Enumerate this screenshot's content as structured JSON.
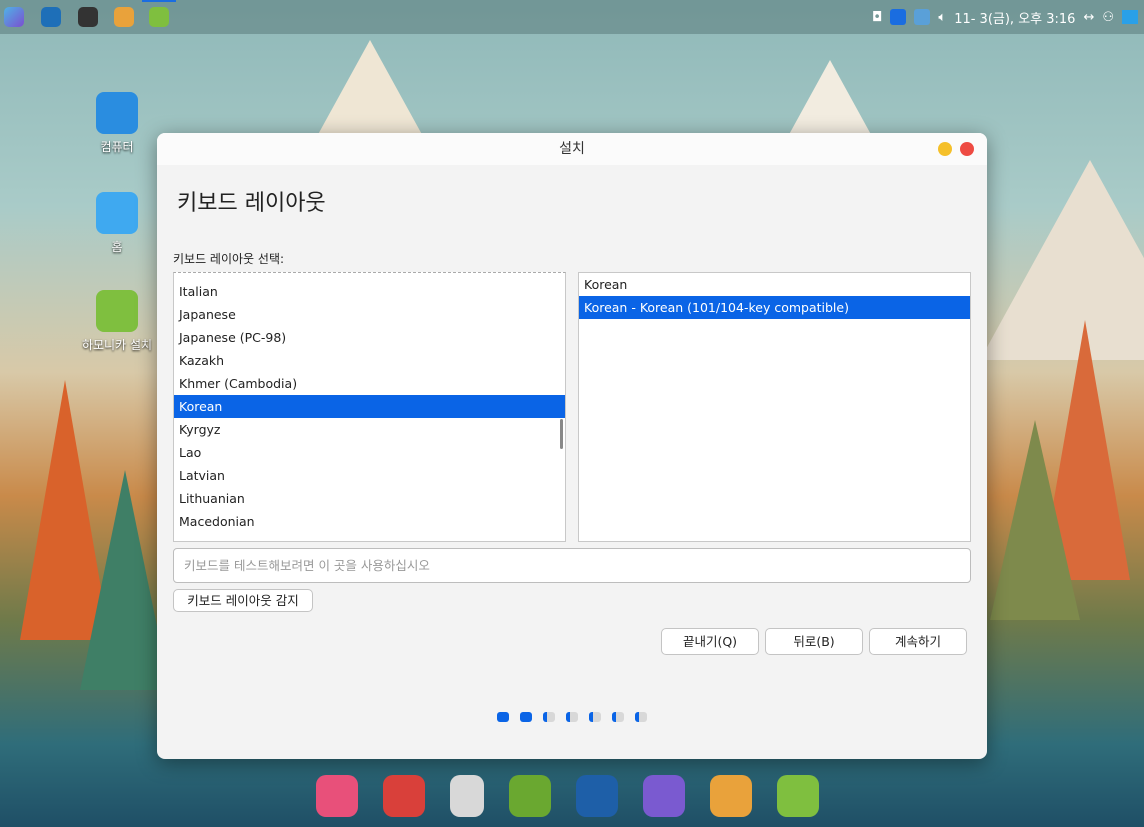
{
  "topbar": {
    "apps": [
      "launcher-icon",
      "browser-icon",
      "terminal-icon",
      "files-icon",
      "installer-icon"
    ],
    "clock": "11- 3(금), 오후 3:16"
  },
  "desktop": {
    "icons": [
      {
        "label": "컴퓨터"
      },
      {
        "label": "홈"
      },
      {
        "label": "하모니카 설치"
      }
    ]
  },
  "window": {
    "title": "설치",
    "heading": "키보드 레이아웃",
    "select_label": "키보드 레이아웃 선택:",
    "layouts": [
      "Italian",
      "Japanese",
      "Japanese (PC-98)",
      "Kazakh",
      "Khmer (Cambodia)",
      "Korean",
      "Kyrgyz",
      "Lao",
      "Latvian",
      "Lithuanian",
      "Macedonian"
    ],
    "selected_layout": "Korean",
    "variants": [
      "Korean",
      "Korean - Korean (101/104-key compatible)"
    ],
    "selected_variant": "Korean - Korean (101/104-key compatible)",
    "test_placeholder": "키보드를 테스트해보려면 이 곳을 사용하십시오",
    "detect_button": "키보드 레이아웃 감지",
    "quit_button": "끝내기(Q)",
    "back_button": "뒤로(B)",
    "continue_button": "계속하기",
    "progress": {
      "total_steps": 7,
      "completed_steps": 2
    },
    "accent": "#0a64e6"
  },
  "dock": {
    "apps": [
      "media-player",
      "power",
      "trash",
      "app-store",
      "browser",
      "video",
      "files",
      "installer"
    ]
  }
}
